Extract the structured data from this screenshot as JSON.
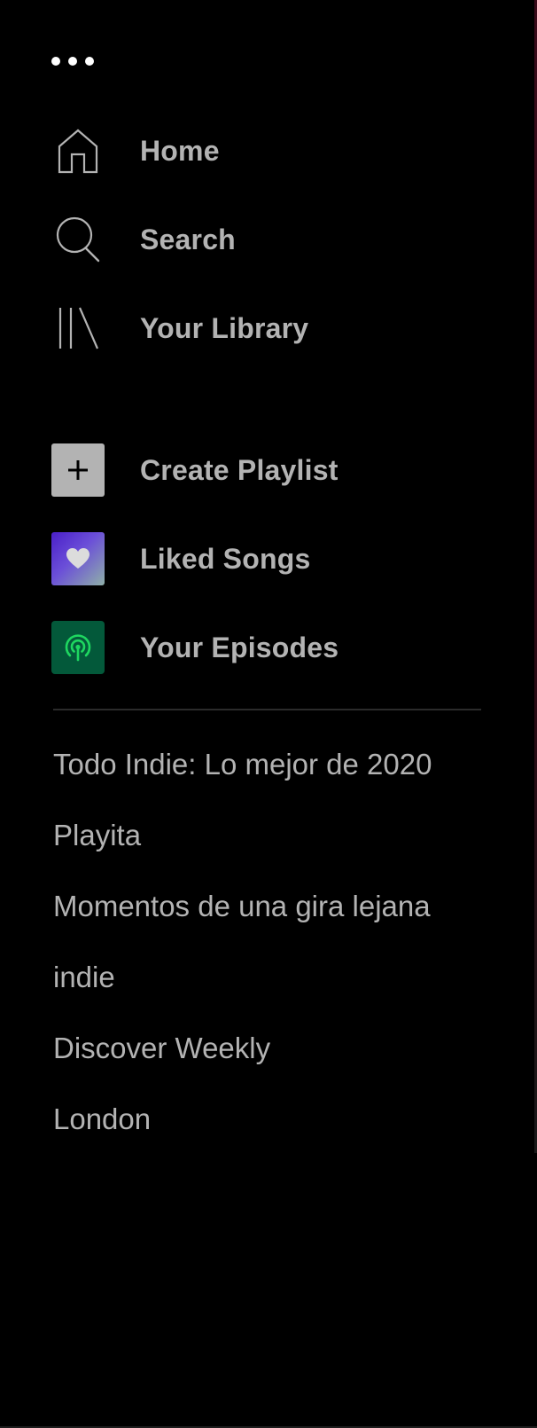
{
  "menu": {
    "more_icon": "ellipsis-icon"
  },
  "nav": {
    "items": [
      {
        "label": "Home",
        "icon": "home-icon"
      },
      {
        "label": "Search",
        "icon": "search-icon"
      },
      {
        "label": "Your Library",
        "icon": "library-icon"
      }
    ]
  },
  "actions": {
    "items": [
      {
        "label": "Create Playlist",
        "icon": "plus-icon"
      },
      {
        "label": "Liked Songs",
        "icon": "heart-icon"
      },
      {
        "label": "Your Episodes",
        "icon": "podcast-icon"
      }
    ]
  },
  "playlists": [
    "Todo Indie: Lo mejor de 2020",
    "Playita",
    "Momentos de una gira lejana",
    "indie",
    "Discover Weekly",
    "London"
  ],
  "colors": {
    "background": "#000000",
    "text": "#b3b3b3",
    "liked_gradient_start": "#4a1fc9",
    "episodes_tile": "#03593a",
    "episodes_icon": "#1ed760"
  }
}
